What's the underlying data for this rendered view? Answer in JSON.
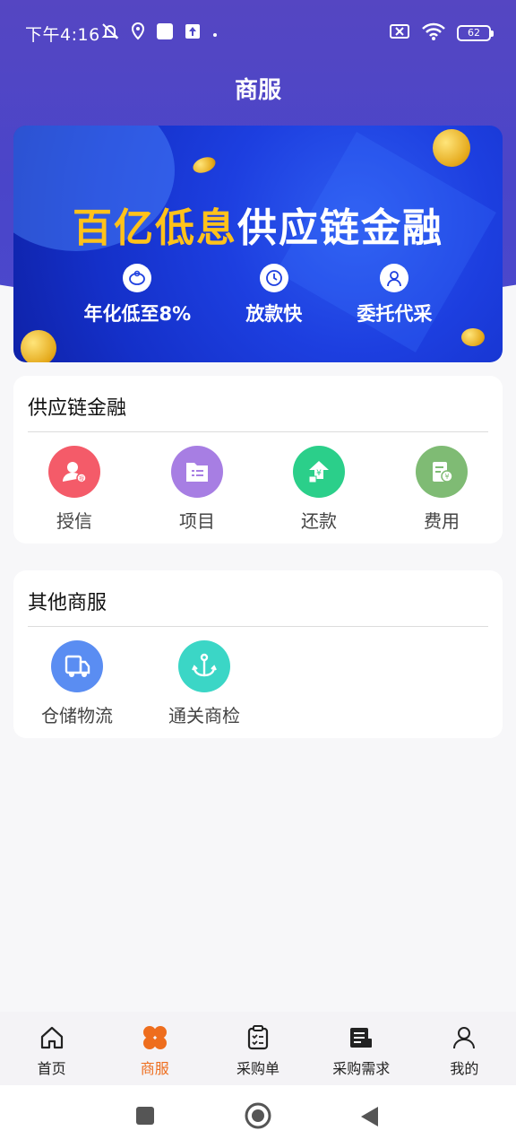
{
  "status_bar": {
    "time": "下午4:16",
    "battery": "62"
  },
  "header": {
    "title": "商服"
  },
  "banner": {
    "headline_highlight": "百亿低息",
    "headline_rest": "供应链金融",
    "features": [
      {
        "label": "年化低至8%",
        "icon": "piggy-bank-icon"
      },
      {
        "label": "放款快",
        "icon": "clock-icon"
      },
      {
        "label": "委托代采",
        "icon": "agent-icon"
      }
    ]
  },
  "supply_chain": {
    "title": "供应链金融",
    "items": [
      {
        "label": "授信",
        "icon": "credit-user-icon",
        "color": "#f45b69"
      },
      {
        "label": "项目",
        "icon": "project-folder-icon",
        "color": "#a77ee3"
      },
      {
        "label": "还款",
        "icon": "repay-icon",
        "color": "#2bcf8a"
      },
      {
        "label": "费用",
        "icon": "fee-icon",
        "color": "#7fbb74"
      }
    ]
  },
  "other_services": {
    "title": "其他商服",
    "items": [
      {
        "label": "仓储物流",
        "icon": "truck-icon",
        "color": "#5a8df2"
      },
      {
        "label": "通关商检",
        "icon": "anchor-icon",
        "color": "#3bd6c6"
      }
    ]
  },
  "tabbar": {
    "active_color": "#ee6d1d",
    "items": [
      {
        "label": "首页",
        "icon": "home-icon"
      },
      {
        "label": "商服",
        "icon": "clover-icon"
      },
      {
        "label": "采购单",
        "icon": "clipboard-icon"
      },
      {
        "label": "采购需求",
        "icon": "document-icon"
      },
      {
        "label": "我的",
        "icon": "user-icon"
      }
    ]
  }
}
